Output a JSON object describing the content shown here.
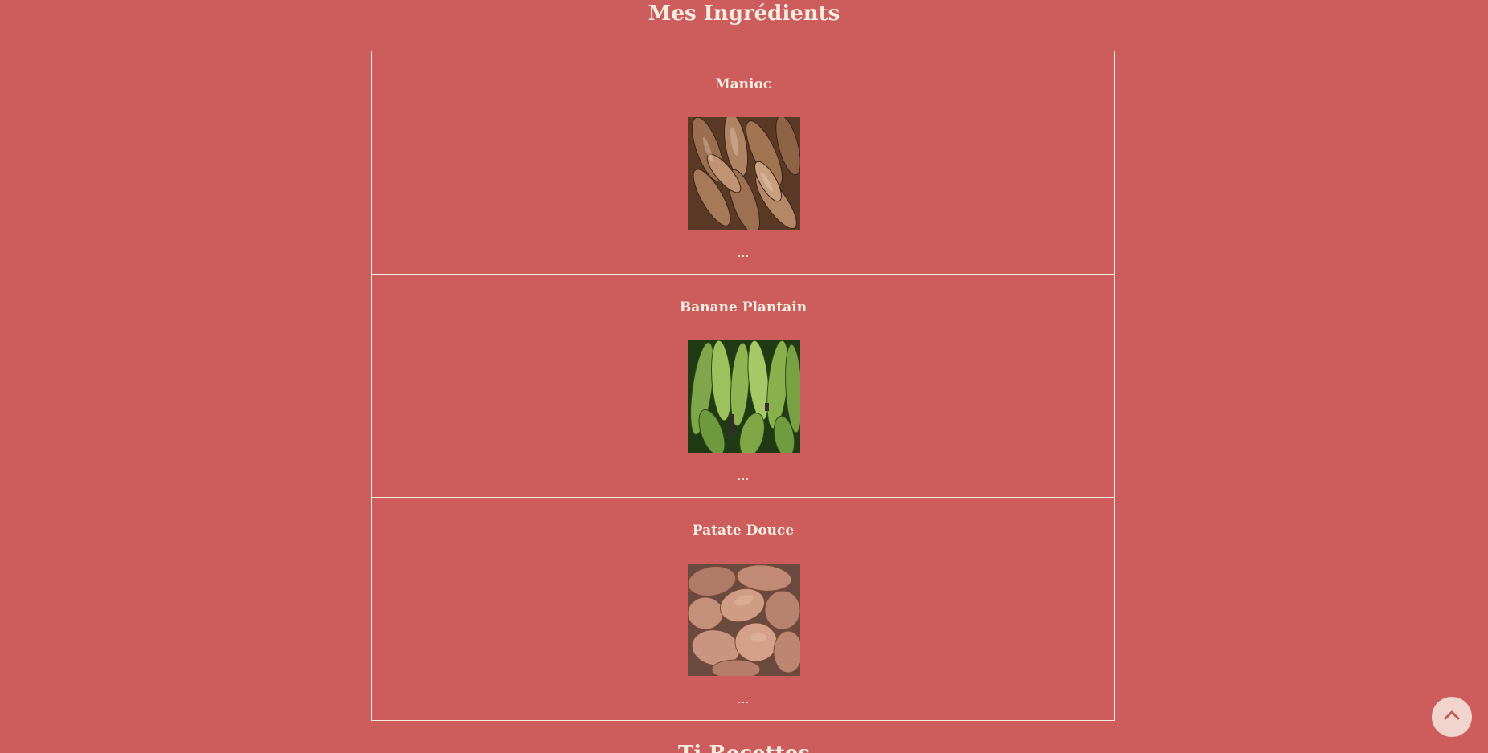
{
  "header": {
    "title": "Mes Ingrédients"
  },
  "ingredients": [
    {
      "name": "Manioc",
      "more": "...",
      "image": "cassava-photo"
    },
    {
      "name": "Banane Plantain",
      "more": "...",
      "image": "plantain-photo"
    },
    {
      "name": "Patate Douce",
      "more": "...",
      "image": "sweet-potato-photo"
    }
  ],
  "next_section": {
    "title": "Ti Recettes"
  },
  "back_to_top": {
    "icon": "chevron-up-icon"
  },
  "colors": {
    "background": "#cd5c5c",
    "text": "#f3ece0",
    "button": "#f1d4cc",
    "button_icon": "#c65a5a"
  }
}
